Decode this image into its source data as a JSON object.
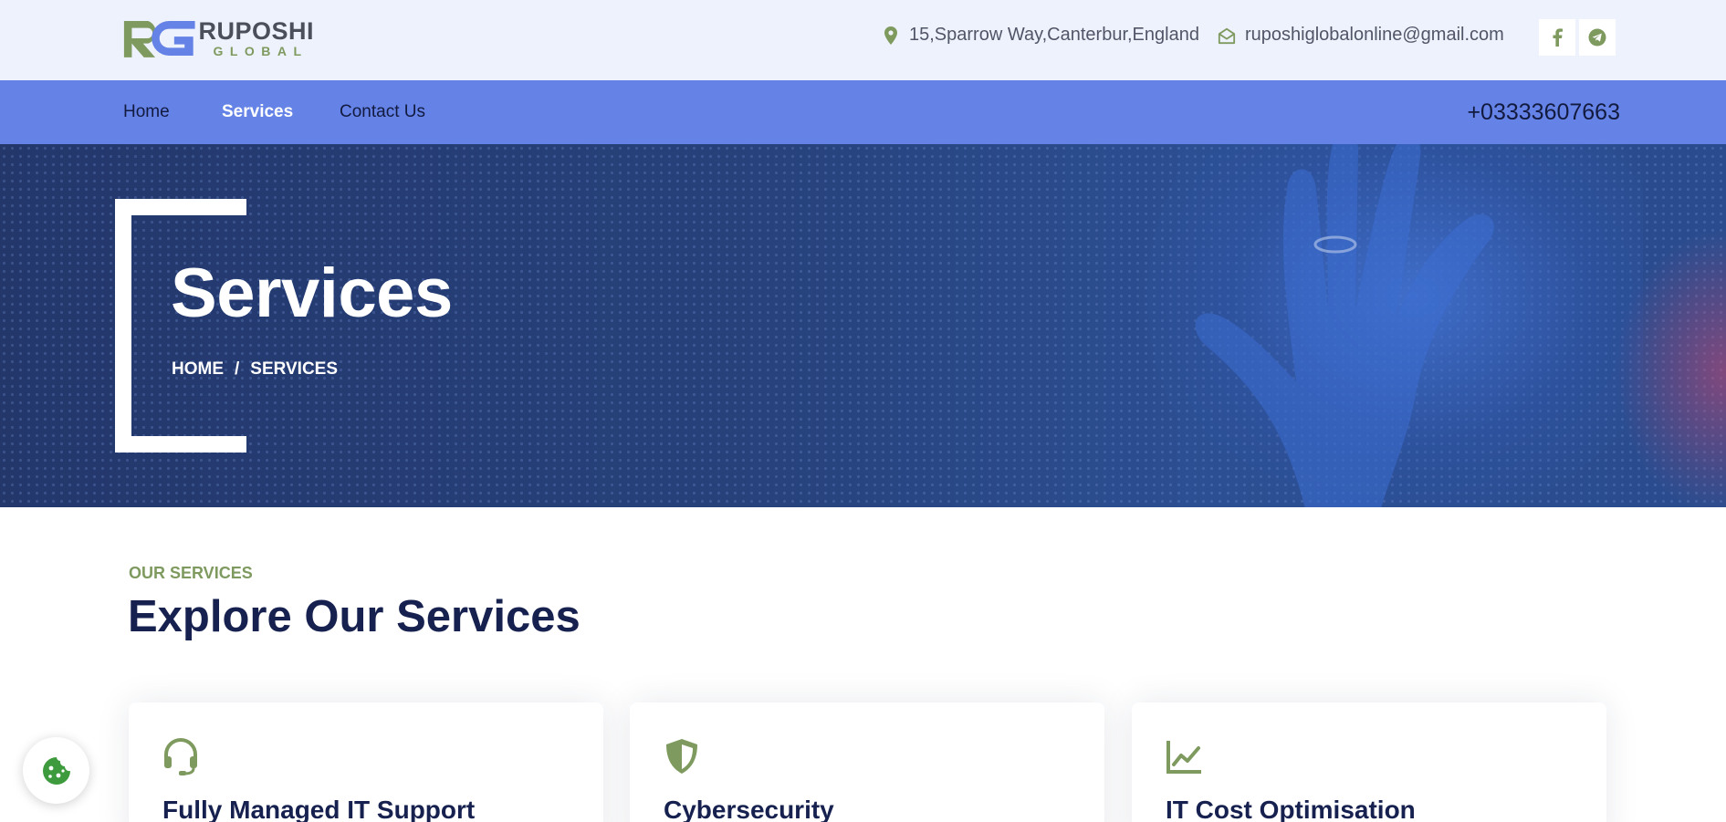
{
  "brand": {
    "name": "RUPOSHI",
    "sub": "GLOBAL",
    "colors": {
      "green": "#7e9a5f",
      "blue": "#6583e6",
      "navy": "#16214f"
    }
  },
  "topbar": {
    "address": "15,Sparrow Way,Canterbur,England",
    "address_icon": "map-pin-icon",
    "email": "ruposhiglobalonline@gmail.com",
    "email_icon": "envelope-open-icon",
    "social": [
      "facebook-icon",
      "telegram-icon"
    ]
  },
  "nav": {
    "items": [
      {
        "label": "Home",
        "active": false
      },
      {
        "label": "Services",
        "active": true
      },
      {
        "label": "Contact Us",
        "active": false
      }
    ],
    "phone": "+03333607663"
  },
  "hero": {
    "title": "Services",
    "breadcrumb": [
      "HOME",
      "/",
      "SERVICES"
    ]
  },
  "services_section": {
    "eyebrow": "OUR SERVICES",
    "title": "Explore Our Services",
    "cards": [
      {
        "title": "Fully Managed IT Support",
        "icon": "headset-icon"
      },
      {
        "title": "Cybersecurity",
        "icon": "shield-icon"
      },
      {
        "title": "IT Cost Optimisation",
        "icon": "line-chart-icon"
      }
    ]
  },
  "cookie_button": {
    "icon": "cookie-icon"
  }
}
